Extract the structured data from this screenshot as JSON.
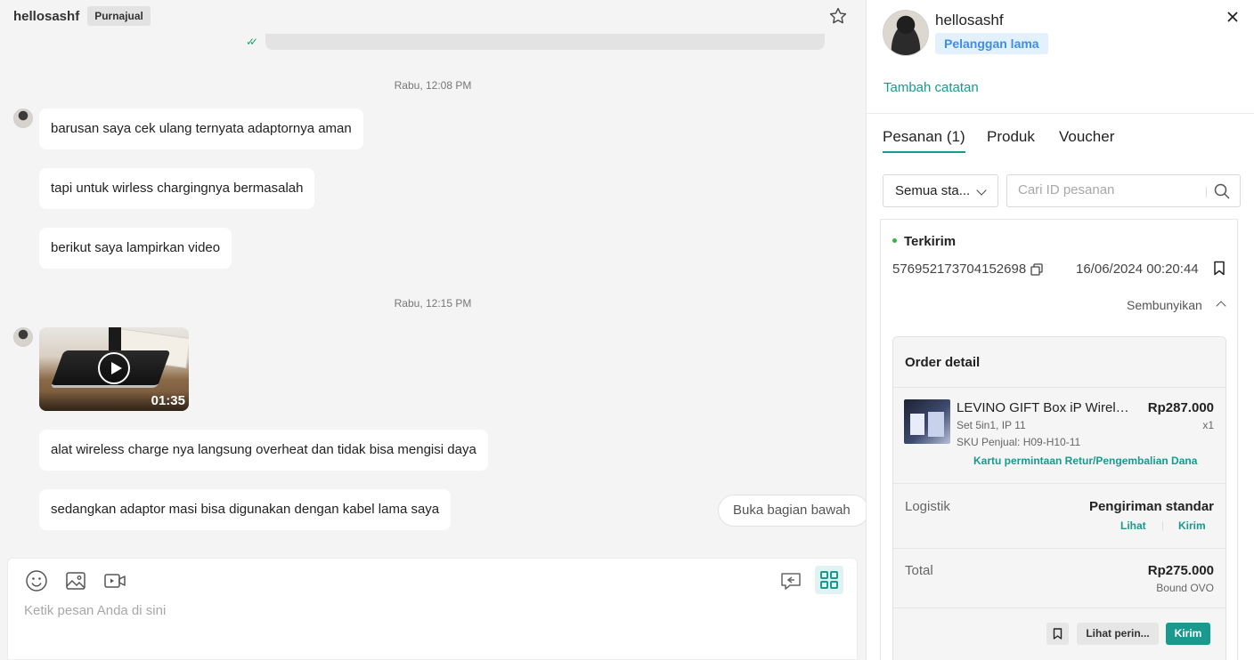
{
  "chat": {
    "header": {
      "username": "hellosashf",
      "badge": "Purnajual"
    },
    "messages": [
      {
        "timestamp": "Rabu, 12:08 PM"
      },
      {
        "text": "barusan saya cek ulang ternyata adaptornya aman"
      },
      {
        "text": "tapi untuk wirless chargingnya bermasalah"
      },
      {
        "text": "berikut saya lampirkan video"
      },
      {
        "timestamp": "Rabu, 12:15 PM"
      },
      {
        "video_duration": "01:35"
      },
      {
        "text": "alat wireless charge nya langsung overheat dan tidak bisa mengisi daya"
      },
      {
        "text": "sedangkan adaptor masi bisa digunakan dengan kabel lama saya"
      }
    ],
    "jump_to_bottom": "Buka bagian bawah",
    "composer": {
      "placeholder": "Ketik pesan Anda di sini"
    },
    "icons": [
      "star-icon",
      "emoji-icon",
      "image-icon",
      "video-icon",
      "quick-reply-icon",
      "grid-icon",
      "read-receipt-icon",
      "play-icon"
    ]
  },
  "panel": {
    "customer": {
      "name": "hellosashf",
      "badge": "Pelanggan lama"
    },
    "add_note": "Tambah catatan",
    "tabs": [
      "Pesanan (1)",
      "Produk",
      "Voucher"
    ],
    "filter": {
      "status_value": "Semua sta...",
      "search_placeholder": "Cari ID pesanan"
    },
    "order": {
      "status": "Terkirim",
      "id": "576952173704152698",
      "date": "16/06/2024 00:20:44",
      "hide_label": "Sembunyikan",
      "detail": {
        "title": "Order detail",
        "product": {
          "name": "LEVINO GIFT Box iP Wireless Charger",
          "price": "Rp287.000",
          "variant": "Set 5in1, IP 11",
          "qty": "x1",
          "sku": "SKU Penjual: H09-H10-11",
          "return_link": "Kartu permintaan Retur/Pengembalian Dana"
        },
        "logistics": {
          "label": "Logistik",
          "value": "Pengiriman standar",
          "view": "Lihat",
          "send": "Kirim"
        },
        "total": {
          "label": "Total",
          "value": "Rp275.000",
          "payment": "Bound OVO"
        },
        "actions": {
          "details": "Lihat perin...",
          "send": "Kirim"
        }
      }
    },
    "colors": {
      "accent": "#1a998f",
      "badge_bg": "#e3f1ff",
      "badge_text": "#3f8ee8",
      "status_green": "#2fb54a"
    }
  }
}
